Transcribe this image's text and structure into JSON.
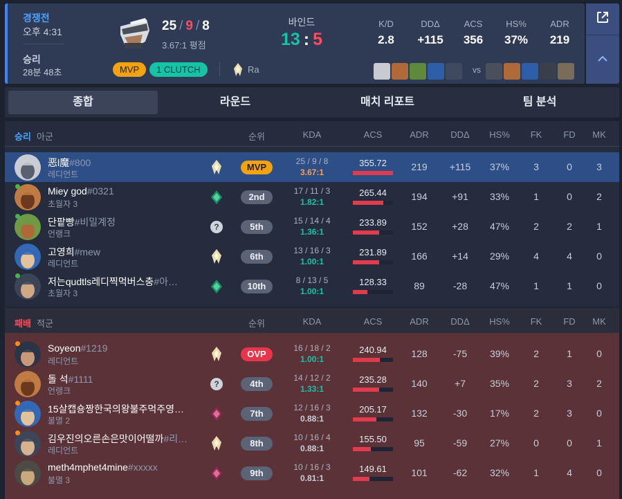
{
  "summary": {
    "mode": "경쟁전",
    "time": "오후 4:31",
    "result": "승리",
    "duration": "28분 48초",
    "kda": {
      "k": "25",
      "d": "9",
      "a": "8"
    },
    "kda_ratio": "3.67:1 평점",
    "badges": {
      "mvp": "MVP",
      "clutch": "1 CLUTCH"
    },
    "rank_name": "Ra",
    "map": "바인드",
    "score": {
      "ours": "13",
      "sep": ":",
      "theirs": "5"
    },
    "vs": "vs",
    "stats": [
      {
        "label": "K/D",
        "value": "2.8"
      },
      {
        "label": "DDΔ",
        "value": "+115"
      },
      {
        "label": "ACS",
        "value": "356"
      },
      {
        "label": "HS%",
        "value": "37%"
      },
      {
        "label": "ADR",
        "value": "219"
      }
    ]
  },
  "tabs": [
    "종합",
    "라운드",
    "매치 리포트",
    "팀 분석"
  ],
  "columns": {
    "rank": "순위",
    "kda": "KDA",
    "acs": "ACS",
    "adr": "ADR",
    "dd": "DDΔ",
    "hs": "HS%",
    "fk": "FK",
    "fd": "FD",
    "mk": "MK"
  },
  "teams": [
    {
      "result": "승리",
      "side": "아군",
      "players": [
        {
          "name": "恶l魔",
          "tag": "#800",
          "agent": "레디언트",
          "rank_icon": "radiant-icon",
          "position": "MVP",
          "kda": "25 / 9 / 8",
          "ratio": "3.67:1",
          "acs": "355.72",
          "acs_fill": 1.0,
          "adr": "219",
          "dd": "+115",
          "hs": "37%",
          "fk": "3",
          "fd": "0",
          "mk": "3"
        },
        {
          "name": "Miey god",
          "tag": "#0321",
          "agent": "초월자 3",
          "rank_icon": "ascendant-icon",
          "position": "2nd",
          "kda": "17 / 11 / 3",
          "ratio": "1.82:1",
          "acs": "265.44",
          "acs_fill": 0.75,
          "adr": "194",
          "dd": "+91",
          "hs": "33%",
          "fk": "1",
          "fd": "0",
          "mk": "2"
        },
        {
          "name": "단팥빵",
          "tag": "#비밀계정",
          "agent": "언랭크",
          "rank_icon": "unranked-icon",
          "position": "5th",
          "kda": "15 / 14 / 4",
          "ratio": "1.36:1",
          "acs": "233.89",
          "acs_fill": 0.66,
          "adr": "152",
          "dd": "+28",
          "hs": "47%",
          "fk": "2",
          "fd": "2",
          "mk": "1"
        },
        {
          "name": "고영희",
          "tag": "#mew",
          "agent": "레디언트",
          "rank_icon": "radiant-icon",
          "position": "6th",
          "kda": "13 / 16 / 3",
          "ratio": "1.00:1",
          "acs": "231.89",
          "acs_fill": 0.65,
          "adr": "166",
          "dd": "+14",
          "hs": "29%",
          "fk": "4",
          "fd": "4",
          "mk": "0"
        },
        {
          "name": "저는qudtls레디찍먹버스충",
          "tag": "#아…",
          "agent": "초월자 3",
          "rank_icon": "ascendant-icon",
          "position": "10th",
          "kda": "8 / 13 / 5",
          "ratio": "1.00:1",
          "acs": "128.33",
          "acs_fill": 0.36,
          "adr": "89",
          "dd": "-28",
          "hs": "47%",
          "fk": "1",
          "fd": "1",
          "mk": "0"
        }
      ]
    },
    {
      "result": "패배",
      "side": "적군",
      "players": [
        {
          "name": "Soyeon",
          "tag": "#1219",
          "agent": "레디언트",
          "rank_icon": "radiant-icon",
          "position": "OVP",
          "kda": "16 / 18 / 2",
          "ratio": "1.00:1",
          "acs": "240.94",
          "acs_fill": 0.68,
          "adr": "128",
          "dd": "-75",
          "hs": "39%",
          "fk": "2",
          "fd": "1",
          "mk": "0"
        },
        {
          "name": "돌 석",
          "tag": "#1111",
          "agent": "언랭크",
          "rank_icon": "unranked-icon",
          "position": "4th",
          "kda": "14 / 12 / 2",
          "ratio": "1.33:1",
          "acs": "235.28",
          "acs_fill": 0.66,
          "adr": "140",
          "dd": "+7",
          "hs": "35%",
          "fk": "2",
          "fd": "3",
          "mk": "2"
        },
        {
          "name": "15살캡숑짱한국의왕불주먹주영…",
          "tag": "",
          "agent": "불멸 2",
          "rank_icon": "immortal-icon",
          "position": "7th",
          "kda": "12 / 16 / 3",
          "ratio": "0.88:1",
          "acs": "205.17",
          "acs_fill": 0.58,
          "adr": "132",
          "dd": "-30",
          "hs": "17%",
          "fk": "2",
          "fd": "3",
          "mk": "0"
        },
        {
          "name": "김우진의오른손은맛이어떨까",
          "tag": "#리…",
          "agent": "레디언트",
          "rank_icon": "radiant-icon",
          "position": "8th",
          "kda": "10 / 16 / 4",
          "ratio": "0.88:1",
          "acs": "155.50",
          "acs_fill": 0.44,
          "adr": "95",
          "dd": "-59",
          "hs": "27%",
          "fk": "0",
          "fd": "0",
          "mk": "1"
        },
        {
          "name": "meth4mphet4mine",
          "tag": "#xxxxx",
          "agent": "불멸 3",
          "rank_icon": "immortal-icon",
          "position": "9th",
          "kda": "10 / 16 / 3",
          "ratio": "0.81:1",
          "acs": "149.61",
          "acs_fill": 0.42,
          "adr": "101",
          "dd": "-62",
          "hs": "32%",
          "fk": "1",
          "fd": "4",
          "mk": "0"
        }
      ]
    }
  ],
  "colors": {
    "win": "#4ea2ff",
    "loss": "#ff4d5e",
    "accent_teal": "#14c4a8",
    "mvp_gold": "#f2a30f",
    "selected_row": "#2e4e88",
    "loss_bg": "#5a3237"
  }
}
